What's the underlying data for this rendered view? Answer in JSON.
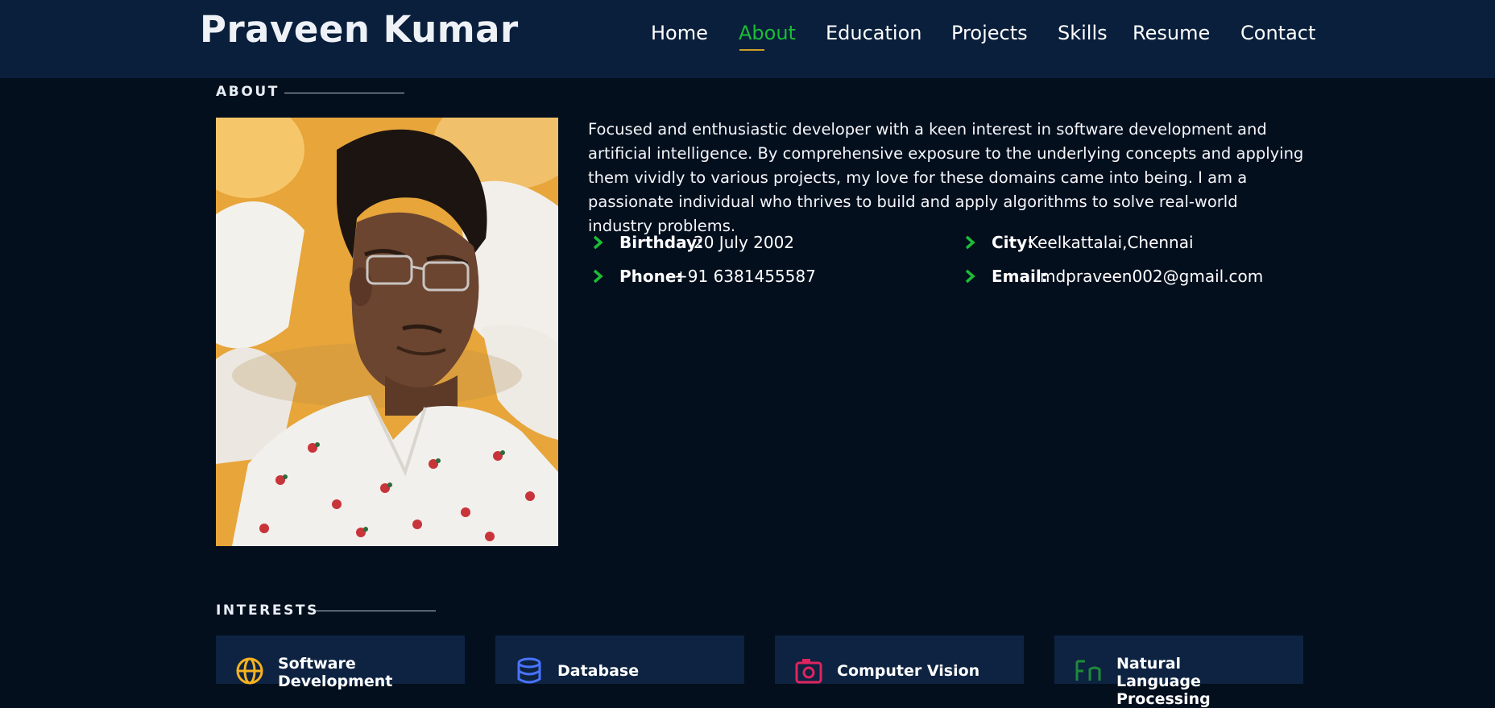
{
  "header": {
    "brand": "Praveen Kumar",
    "nav": [
      "Home",
      "About",
      "Education",
      "Projects",
      "Skills",
      "Resume",
      "Contact"
    ],
    "active_nav": "About",
    "accent_color": "#1bbd36",
    "underline_color": "#c8a227"
  },
  "about": {
    "section_title": "ABOUT",
    "bio": "Focused and enthusiastic developer with a keen interest in software development and artificial intelligence. By comprehensive exposure to the underlying concepts and applying them vividly to various projects, my love for these domains came into being. I am a passionate individual who thrives to build and apply algorithms to solve real-world industry problems.",
    "details": {
      "birthday_label": "Birthday:",
      "birthday": "20 July 2002",
      "city_label": "City:",
      "city": "Keelkattalai,Chennai",
      "phone_label": "Phone:",
      "phone": "+91 6381455587",
      "email_label": "Email:",
      "email": "mdpraveen002@gmail.com"
    }
  },
  "interests": {
    "section_title": "INTERESTS",
    "items": [
      {
        "label": "Software Development",
        "icon": "globe-icon",
        "color": "#f6b221"
      },
      {
        "label": "Database",
        "icon": "database-icon",
        "color": "#4a73ff"
      },
      {
        "label": "Computer Vision",
        "icon": "camera-icon",
        "color": "#e0245e"
      },
      {
        "label": "Natural Language Processing",
        "icon": "english-font-icon",
        "color": "#1f8a3a"
      }
    ]
  }
}
